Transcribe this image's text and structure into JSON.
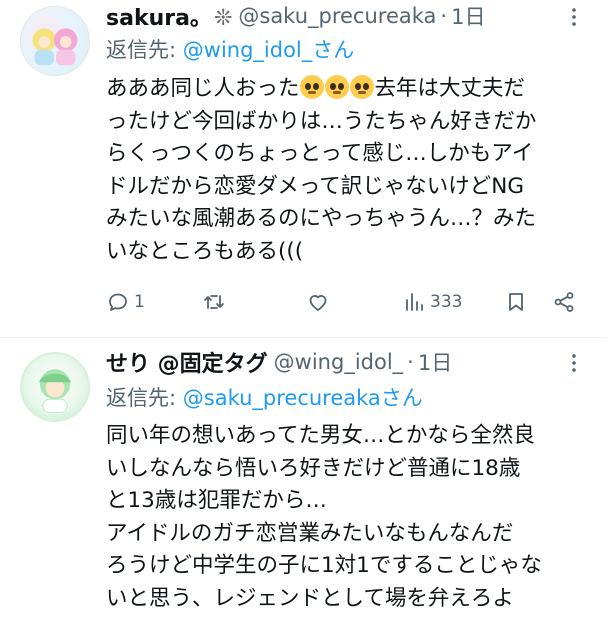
{
  "tweets": [
    {
      "name": "sakura。",
      "name_symbol": "❊",
      "handle": "@saku_precureaka",
      "separator": "·",
      "time": "1日",
      "reply_prefix": "返信先: ",
      "reply_mention": "@wing_idol_さん",
      "lines": [
        {
          "before": "あああ同じ人おった",
          "emoji": [
            "pleading-face-emoji",
            "pleading-face-emoji",
            "pleading-face-emoji"
          ],
          "after": "去年は大丈夫だ"
        },
        "ったけど今回ばかりは…うたちゃん好きだか",
        "らくっつくのちょっとって感じ…しかもアイ",
        "ドルだから恋愛ダメって訳じゃないけどNG",
        "みたいな風潮あるのにやっちゃうん…？みた",
        "いなところもある((("
      ],
      "replies": "1",
      "retweets": "",
      "likes": "",
      "views": "333"
    },
    {
      "name": "せり @固定タグ",
      "handle": "@wing_idol_",
      "separator": "·",
      "time": "1日",
      "reply_prefix": "返信先: ",
      "reply_mention": "@saku_precureakaさん",
      "lines": [
        "同い年の想いあってた男女…とかなら全然良",
        "いしなんなら悟いろ好きだけど普通に18歳",
        "と13歳は犯罪だから…",
        "アイドルのガチ恋営業みたいなもんなんだ",
        "ろうけど中学生の子に1対1ですることじゃな",
        "いと思う、レジェンドとして場を弁えろよ"
      ]
    }
  ],
  "colors": {
    "text": "#0f1419",
    "secondary": "#536471",
    "link": "#1d9bf0",
    "divider": "#eff3f4"
  },
  "icons": [
    "more-icon",
    "reply-icon",
    "retweet-icon",
    "like-icon",
    "views-icon",
    "bookmark-icon",
    "share-icon"
  ]
}
